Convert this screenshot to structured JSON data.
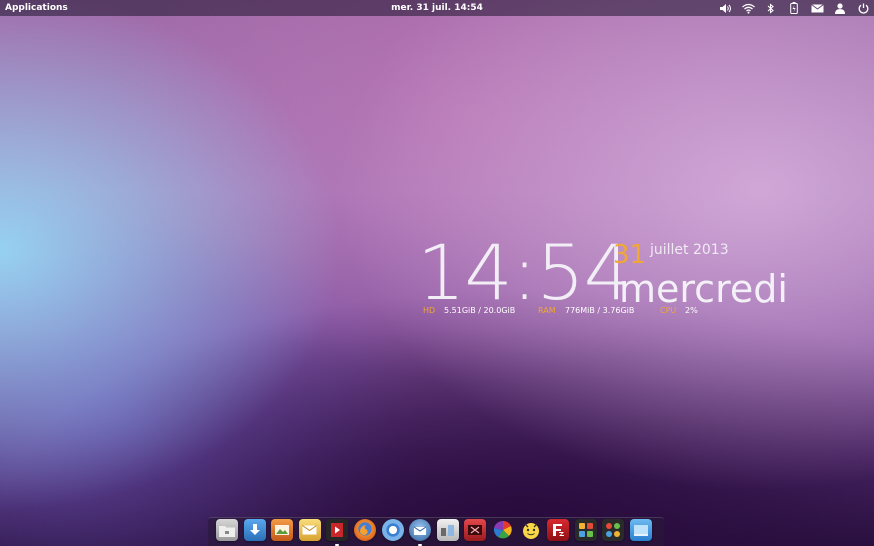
{
  "panel": {
    "applications_label": "Applications",
    "clock_text": "mer. 31 juil. 14:54",
    "indicators": [
      {
        "name": "sound-icon"
      },
      {
        "name": "wifi-icon"
      },
      {
        "name": "bluetooth-icon"
      },
      {
        "name": "battery-icon"
      },
      {
        "name": "mail-icon"
      },
      {
        "name": "user-icon"
      },
      {
        "name": "power-icon"
      }
    ]
  },
  "widget": {
    "time": "14:54",
    "day": "31",
    "month_year": "juillet 2013",
    "weekday": "mercredi",
    "stats": {
      "hd_label": "HD",
      "hd_value": "5.51GiB / 20.0GiB",
      "ram_label": "RAM",
      "ram_value": "776MiB  / 3.76GiB",
      "cpu_label": "CPU",
      "cpu_value": "2%"
    },
    "colors": {
      "accent": "#f0a733",
      "text": "#f2eef5"
    }
  },
  "dock": {
    "apps": [
      {
        "name": "files-icon",
        "color": "#b9b9b9"
      },
      {
        "name": "downloads-icon",
        "color": "#3d8fd8"
      },
      {
        "name": "photos-icon",
        "color": "#e07b2a"
      },
      {
        "name": "mail-client-icon",
        "color": "#f0c24a"
      },
      {
        "name": "video-player-icon",
        "color": "#2a2a2a"
      },
      {
        "name": "firefox-icon",
        "color": "#e8662a"
      },
      {
        "name": "chromium-icon",
        "color": "#4a8cd0"
      },
      {
        "name": "thunderbird-icon",
        "color": "#3f6fb0"
      },
      {
        "name": "system-monitor-icon",
        "color": "#d8d8d8"
      },
      {
        "name": "screen-recorder-icon",
        "color": "#c0262d"
      },
      {
        "name": "picasa-icon",
        "color": "#ffffff"
      },
      {
        "name": "skype-icon",
        "color": "#f5d33b"
      },
      {
        "name": "filezilla-icon",
        "color": "#b3161c"
      },
      {
        "name": "app-grid-icon",
        "color": "#2a2a2a"
      },
      {
        "name": "app-launcher-icon",
        "color": "#2a2a2a"
      },
      {
        "name": "desktop-icon",
        "color": "#3d9ae0"
      }
    ]
  }
}
